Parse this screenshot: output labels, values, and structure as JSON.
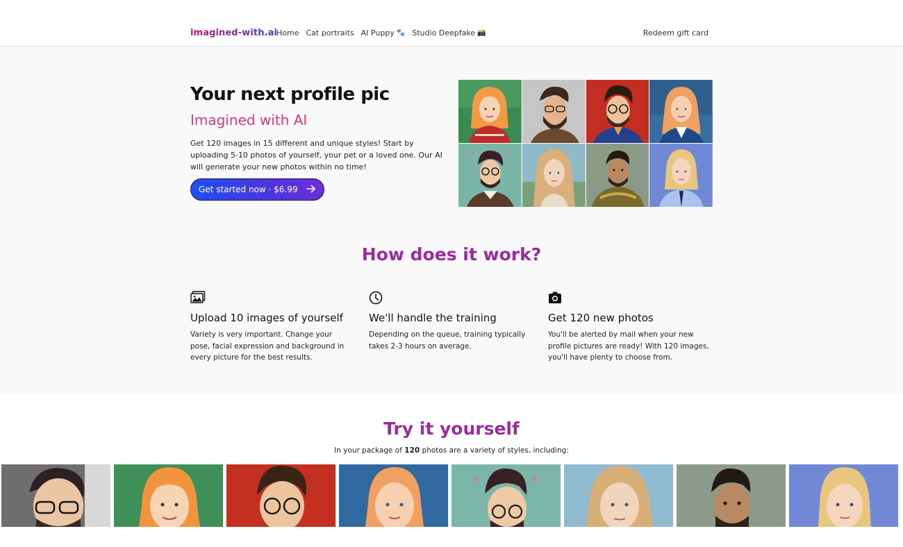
{
  "nav": {
    "brand": "imagined-with.ai",
    "links": [
      {
        "label": "Home"
      },
      {
        "label": "Cat portraits"
      },
      {
        "label": "AI Puppy",
        "emoji": "🐾"
      },
      {
        "label": "Studio Deepfake",
        "emoji": "📸"
      }
    ],
    "redeem": "Redeem gift card"
  },
  "hero": {
    "title": "Your next profile pic",
    "subtitle": "Imagined with AI",
    "description": "Get 120 images in 15 different and unique styles! Start by uploading 5-10 photos of yourself, your pet or a loved one. Our AI will generate your new photos within no time!",
    "cta_label": "Get started now · $6.99"
  },
  "how": {
    "title": "How does it work?",
    "steps": [
      {
        "icon": "images-icon",
        "title": "Upload 10 images of yourself",
        "text": "Variety is very important. Change your pose, facial expression and background in every picture for the best results."
      },
      {
        "icon": "clock-icon",
        "title": "We'll handle the training",
        "text": "Depending on the queue, training typically takes 2-3 hours on average."
      },
      {
        "icon": "camera-icon",
        "title": "Get 120 new photos",
        "text": "You'll be alerted by mail when your new profile pictures are ready! With 120 images, you'll have plenty to choose from."
      }
    ]
  },
  "try": {
    "title": "Try it yourself",
    "subtitle_pre": "In your package of ",
    "subtitle_bold": "120",
    "subtitle_post": " photos are a variety of styles, including:"
  },
  "colors": {
    "accent_purple": "#9c2aa0",
    "accent_pink": "#d63a7f",
    "cta_blue": "#1f4ff0"
  }
}
